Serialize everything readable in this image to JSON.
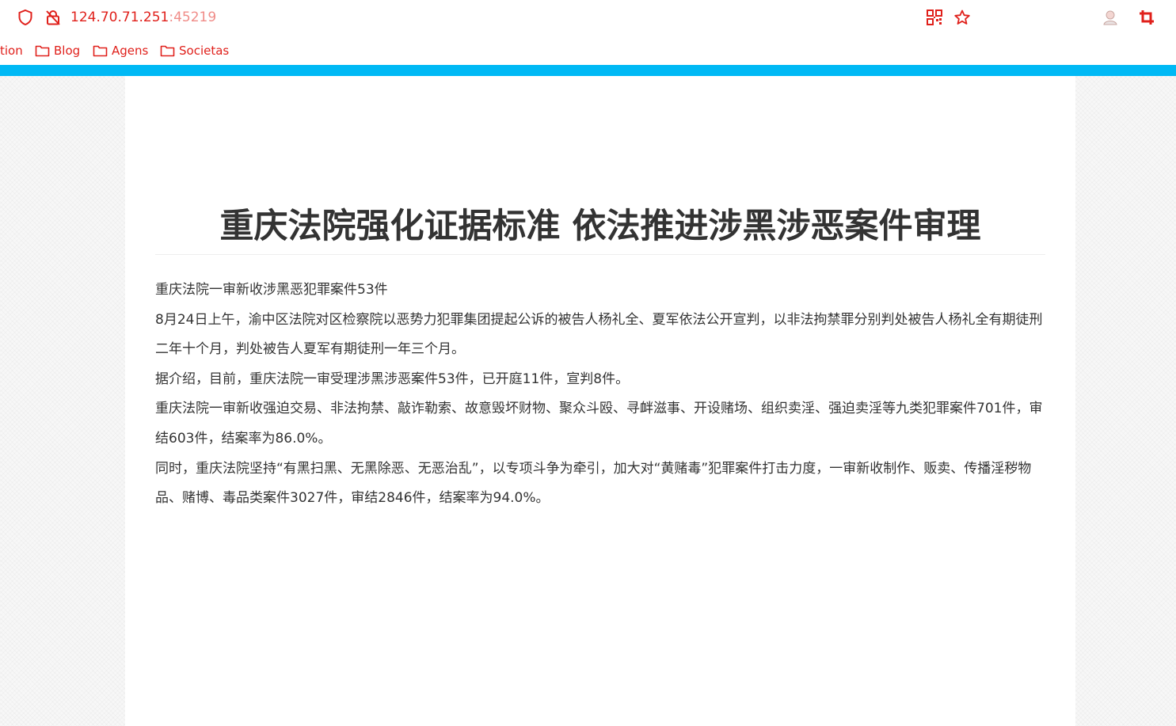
{
  "browser": {
    "url_host": "124.70.71.251",
    "url_port": ":45219",
    "bookmarks": [
      "tion",
      "Blog",
      "Agens",
      "Societas"
    ]
  },
  "colors": {
    "accent_bar": "#00b9f5",
    "browser_red": "#e0201b"
  },
  "icons": {
    "left": [
      "shield-icon",
      "insecure-lock-icon"
    ],
    "right": [
      "qr-code-icon",
      "bookmark-star-icon",
      "avatar-icon",
      "crop-extension-icon"
    ]
  },
  "article": {
    "title": "重庆法院强化证据标准 依法推进涉黑涉恶案件审理",
    "paragraphs": [
      "重庆法院一审新收涉黑恶犯罪案件53件",
      "8月24日上午，渝中区法院对区检察院以恶势力犯罪集团提起公诉的被告人杨礼全、夏军依法公开宣判，以非法拘禁罪分别判处被告人杨礼全有期徒刑二年十个月，判处被告人夏军有期徒刑一年三个月。",
      "据介绍，目前，重庆法院一审受理涉黑涉恶案件53件，已开庭11件，宣判8件。",
      "重庆法院一审新收强迫交易、非法拘禁、敲诈勒索、故意毁坏财物、聚众斗殴、寻衅滋事、开设赌场、组织卖淫、强迫卖淫等九类犯罪案件701件，审结603件，结案率为86.0%。",
      "同时，重庆法院坚持“有黑扫黑、无黑除恶、无恶治乱”，以专项斗争为牵引，加大对“黄赌毒”犯罪案件打击力度，一审新收制作、贩卖、传播淫秽物品、赌博、毒品类案件3027件，审结2846件，结案率为94.0%。"
    ]
  }
}
